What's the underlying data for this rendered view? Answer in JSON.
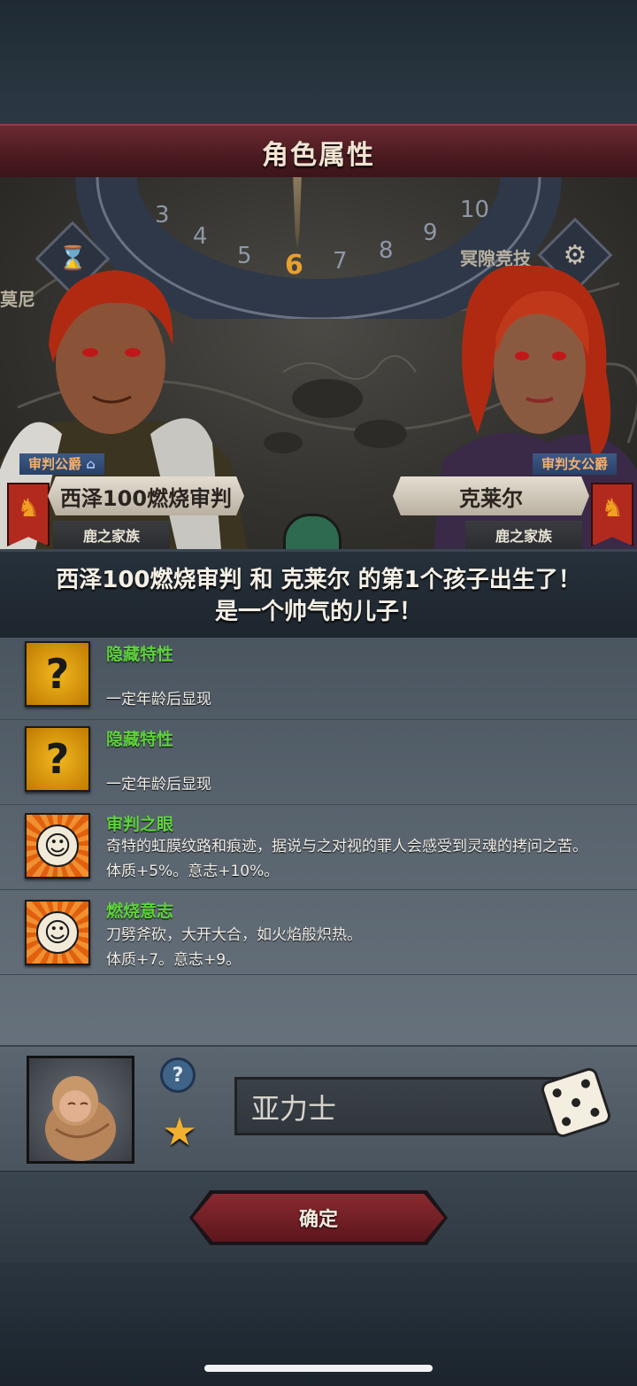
{
  "title": "角色属性",
  "scene": {
    "dial_numbers": [
      "3",
      "4",
      "5",
      "6",
      "7",
      "8",
      "9",
      "10"
    ],
    "dial_current": "6",
    "bg_label_right": "冥隙竞技",
    "bg_label_left": "莫尼"
  },
  "father": {
    "rank": "审判公爵",
    "name": "西泽100燃烧审判",
    "house": "鹿之家族"
  },
  "mother": {
    "rank": "审判女公爵",
    "name": "克莱尔",
    "house": "鹿之家族"
  },
  "announcement": {
    "line1": "西泽100燃烧审判 和 克莱尔 的第1个孩子出生了！",
    "line2": "是一个帅气的儿子！"
  },
  "traits": [
    {
      "icon": "question-icon",
      "glyph": "?",
      "name": "隐藏特性",
      "desc1": "",
      "desc2": "一定年龄后显现"
    },
    {
      "icon": "question-icon",
      "glyph": "?",
      "name": "隐藏特性",
      "desc1": "",
      "desc2": "一定年龄后显现"
    },
    {
      "icon": "smile-icon",
      "glyph": "☺",
      "name": "审判之眼",
      "desc1": "奇特的虹膜纹路和痕迹，据说与之对视的罪人会感受到灵魂的拷问之苦。",
      "desc2": "体质+5%。意志+10%。"
    },
    {
      "icon": "smile-icon",
      "glyph": "☺",
      "name": "燃烧意志",
      "desc1": "刀劈斧砍，大开大合，如火焰般炽热。",
      "desc2": "体质+7。意志+9。"
    }
  ],
  "child": {
    "name_value": "亚力士",
    "help_glyph": "?",
    "star_glyph": "★"
  },
  "confirm_label": "确定",
  "colors": {
    "trait_name": "#5fd23c",
    "title_bar": "#6b2a32",
    "confirm": "#8a2a30"
  }
}
